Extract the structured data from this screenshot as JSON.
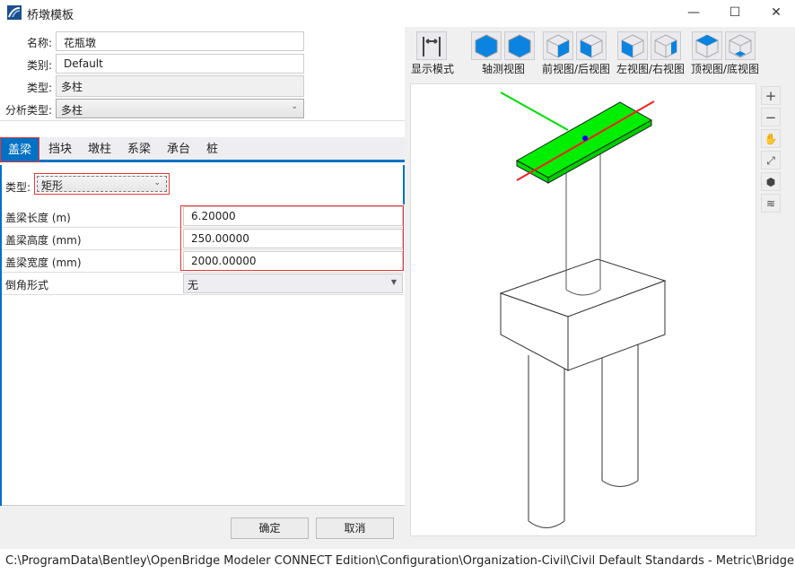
{
  "window": {
    "title": "桥墩模板",
    "minimize": "—",
    "maximize": "☐",
    "close": "✕"
  },
  "form": {
    "name_label": "名称:",
    "name_value": "花瓶墩",
    "category_label": "类别:",
    "category_value": "Default",
    "type_label": "类型:",
    "type_value": "多柱",
    "analysis_label": "分析类型:",
    "analysis_value": "多柱"
  },
  "tabs": [
    "盖梁",
    "挡块",
    "墩柱",
    "系梁",
    "承台",
    "桩"
  ],
  "active_tab": "盖梁",
  "cap_type": {
    "label": "类型:",
    "value": "矩形"
  },
  "properties": [
    {
      "name": "盖梁长度 (m)",
      "value": "6.20000"
    },
    {
      "name": "盖梁高度 (mm)",
      "value": "250.00000"
    },
    {
      "name": "盖梁宽度 (mm)",
      "value": "2000.00000"
    },
    {
      "name": "倒角形式",
      "value": "无"
    }
  ],
  "buttons": {
    "ok": "确定",
    "cancel": "取消"
  },
  "toolbar": {
    "display_mode": "显示模式",
    "axonometric": "轴测视图",
    "front_back": "前视图/后视图",
    "left_right": "左视图/右视图",
    "top_bottom": "顶视图/底视图"
  },
  "side_tools": {
    "zoom_in": "+",
    "zoom_out": "−"
  },
  "status_path": "C:\\ProgramData\\Bentley\\OpenBridge Modeler CONNECT Edition\\Configuration\\Organization-Civil\\Civil Default Standards - Metric\\Bridge Templates\\Pie",
  "colors": {
    "accent": "#0071c5",
    "highlight": "#e33333",
    "cap_beam": "#00ee00"
  }
}
